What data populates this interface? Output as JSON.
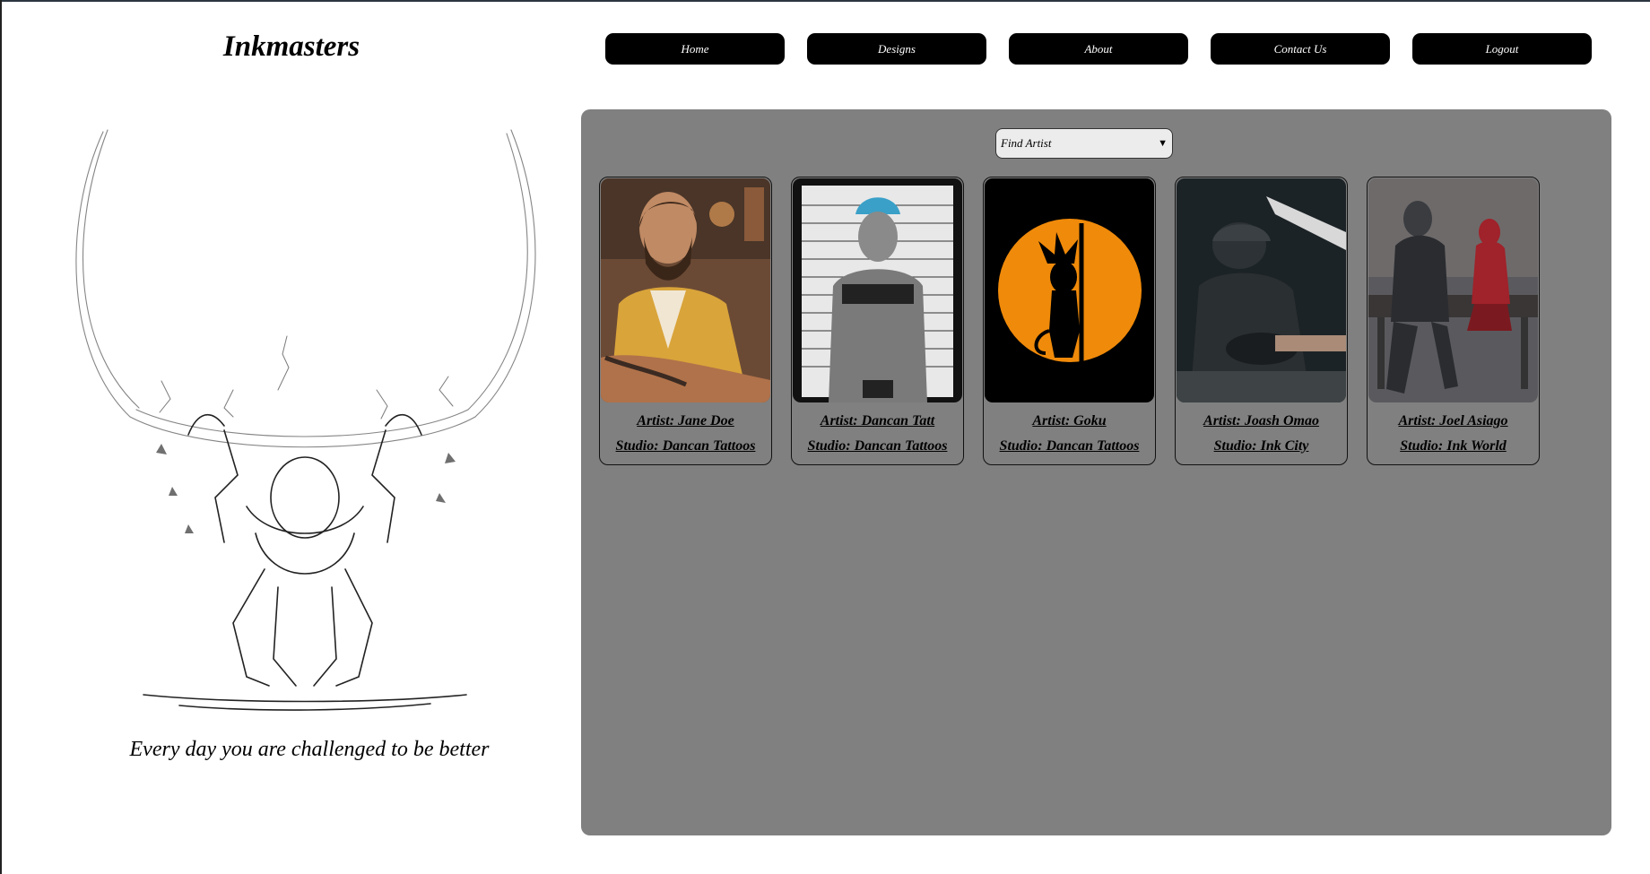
{
  "brand": {
    "name": "Inkmasters"
  },
  "nav": {
    "items": [
      {
        "label": "Home"
      },
      {
        "label": "Designs"
      },
      {
        "label": "About"
      },
      {
        "label": "Contact Us"
      },
      {
        "label": "Logout"
      }
    ]
  },
  "hero": {
    "image": "atlas-sketch-image",
    "tagline": "Every day you are challenged to be better"
  },
  "finder": {
    "selected": "Find Artist",
    "icon": "chevron-down-icon"
  },
  "artists": [
    {
      "name": "Artist: Jane Doe",
      "studio": "Studio: Dancan Tattoos",
      "photo": "tattooed-man-portrait"
    },
    {
      "name": "Artist: Dancan Tatt",
      "studio": "Studio: Dancan Tattoos",
      "photo": "mugshot-portrait"
    },
    {
      "name": "Artist: Goku",
      "studio": "Studio: Dancan Tattoos",
      "photo": "silhouette-orange-sun"
    },
    {
      "name": "Artist: Joash Omao",
      "studio": "Studio: Ink City",
      "photo": "tattoo-artist-working"
    },
    {
      "name": "Artist: Joel Asiago",
      "studio": "Studio: Ink World",
      "photo": "armored-characters-scene"
    }
  ],
  "colors": {
    "panel": "#808080",
    "nav_button": "#000000",
    "accent_orange": "#f08a0a"
  }
}
